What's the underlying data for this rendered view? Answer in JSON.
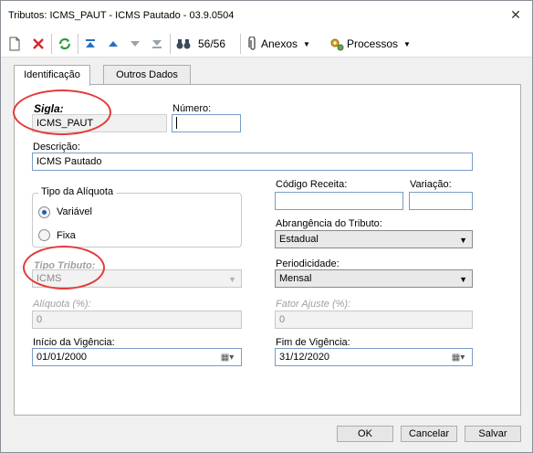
{
  "window": {
    "title": "Tributos: ICMS_PAUT - ICMS Pautado - 03.9.0504",
    "close_glyph": "✕"
  },
  "toolbar": {
    "record_counter": "56/56",
    "anexos_label": "Anexos",
    "processos_label": "Processos"
  },
  "tabs": [
    {
      "label": "Identificação",
      "active": true
    },
    {
      "label": "Outros Dados",
      "active": false
    }
  ],
  "form": {
    "sigla": {
      "label": "Sigla:",
      "value": "ICMS_PAUT"
    },
    "numero": {
      "label": "Número:",
      "value": ""
    },
    "descricao": {
      "label": "Descrição:",
      "value": "ICMS Pautado"
    },
    "tipo_aliquota": {
      "title": "Tipo da Alíquota",
      "options": [
        {
          "label": "Variável",
          "checked": true
        },
        {
          "label": "Fixa",
          "checked": false
        }
      ]
    },
    "tipo_tributo": {
      "label": "Tipo Tributo:",
      "value": "ICMS"
    },
    "aliquota": {
      "label": "Alíquota (%):",
      "value": "0"
    },
    "inicio_vigencia": {
      "label": "Início da Vigência:",
      "value": "01/01/2000"
    },
    "codigo_receita": {
      "label": "Código Receita:",
      "value": ""
    },
    "variacao": {
      "label": "Variação:",
      "value": ""
    },
    "abrangencia": {
      "label": "Abrangência do Tributo:",
      "value": "Estadual"
    },
    "periodicidade": {
      "label": "Periodicidade:",
      "value": "Mensal"
    },
    "fator_ajuste": {
      "label": "Fator Ajuste (%):",
      "value": "0"
    },
    "fim_vigencia": {
      "label": "Fim de Vigência:",
      "value": "31/12/2020"
    }
  },
  "footer": {
    "ok_label": "OK",
    "cancel_label": "Cancelar",
    "save_label": "Salvar"
  },
  "colors": {
    "highlight_circle": "#e23a3a",
    "field_border": "#7a9cc6",
    "selected_radio": "#1c5fa8"
  }
}
